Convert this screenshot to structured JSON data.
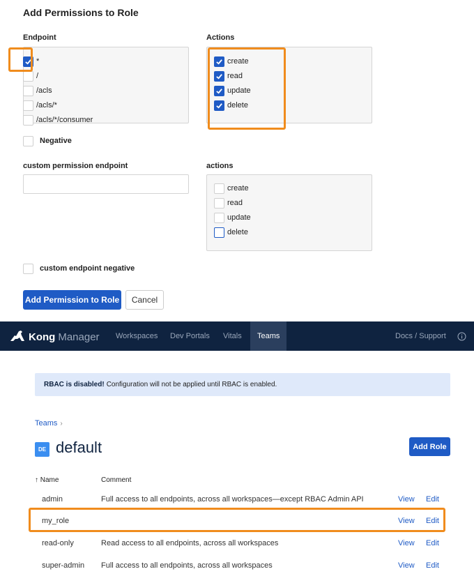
{
  "form": {
    "title": "Add Permissions to Role",
    "endpoint_label": "Endpoint",
    "actions_label": "Actions",
    "endpoints": [
      {
        "label": "*",
        "checked": true
      },
      {
        "label": "/",
        "checked": false
      },
      {
        "label": "/acls",
        "checked": false
      },
      {
        "label": "/acls/*",
        "checked": false
      },
      {
        "label": "/acls/*/consumer",
        "checked": false
      }
    ],
    "actions": [
      {
        "label": "create",
        "checked": true
      },
      {
        "label": "read",
        "checked": true
      },
      {
        "label": "update",
        "checked": true
      },
      {
        "label": "delete",
        "checked": true
      }
    ],
    "negative_label": "Negative",
    "custom_endpoint_label": "custom permission endpoint",
    "custom_endpoint_value": "",
    "custom_actions_label": "actions",
    "custom_actions": [
      {
        "label": "create",
        "checked": false
      },
      {
        "label": "read",
        "checked": false
      },
      {
        "label": "update",
        "checked": false
      },
      {
        "label": "delete",
        "checked": false
      }
    ],
    "custom_negative_label": "custom endpoint negative",
    "submit_label": "Add Permission to Role",
    "cancel_label": "Cancel"
  },
  "nav": {
    "brand_bold": "Kong",
    "brand_light": "Manager",
    "items": [
      "Workspaces",
      "Dev Portals",
      "Vitals",
      "Teams"
    ],
    "active": "Teams",
    "right_link": "Docs / Support",
    "info_icon": "info-icon"
  },
  "alert": {
    "bold": "RBAC is disabled!",
    "text": "Configuration will not be applied until RBAC is enabled."
  },
  "team": {
    "breadcrumb": "Teams",
    "badge": "DE",
    "name": "default",
    "add_role_label": "Add Role"
  },
  "table": {
    "headers": {
      "name": "↑ Name",
      "comment": "Comment"
    },
    "rows": [
      {
        "name": "admin",
        "comment": "Full access to all endpoints, across all workspaces—except RBAC Admin API",
        "view": "View",
        "edit": "Edit"
      },
      {
        "name": "my_role",
        "comment": "",
        "view": "View",
        "edit": "Edit"
      },
      {
        "name": "read-only",
        "comment": "Read access to all endpoints, across all workspaces",
        "view": "View",
        "edit": "Edit"
      },
      {
        "name": "super-admin",
        "comment": "Full access to all endpoints, across all workspaces",
        "view": "View",
        "edit": "Edit"
      }
    ]
  },
  "colors": {
    "primary": "#1f5bc5",
    "nav_bg": "#0f2340",
    "highlight": "#f08c1d",
    "alert_bg": "#dfe9fa"
  }
}
